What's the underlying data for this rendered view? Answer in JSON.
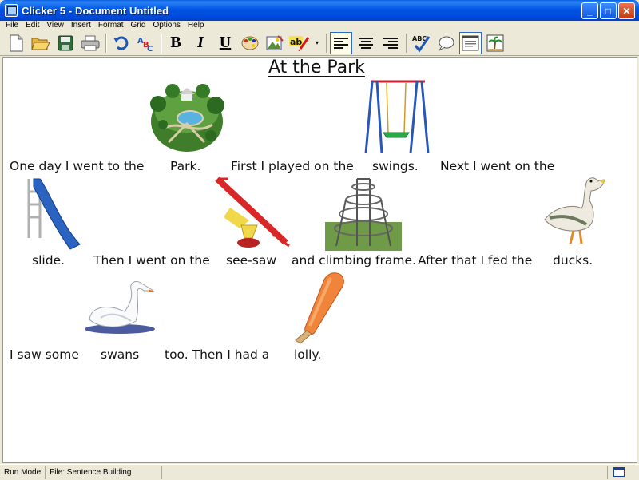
{
  "window": {
    "title": "Clicker 5 - Document Untitled",
    "controls": {
      "minimize": "_",
      "maximize": "□",
      "close": "✕"
    }
  },
  "menu": [
    "File",
    "Edit",
    "View",
    "Insert",
    "Format",
    "Grid",
    "Options",
    "Help"
  ],
  "toolbar": {
    "bold": "B",
    "italic": "I",
    "underline": "U",
    "abc_label": "ABC",
    "spell_label": "ab",
    "spell_sub": "c",
    "dropdown": "▾"
  },
  "document": {
    "title": "At the Park",
    "lines": [
      {
        "segments": [
          "One day I went to the",
          "Park.",
          "First I played on the",
          "swings.",
          "Next I went on the"
        ]
      },
      {
        "segments": [
          "slide.",
          "Then I went on the",
          "see-saw",
          "and climbing frame.",
          "After that I fed the",
          "ducks."
        ]
      },
      {
        "segments": [
          "I saw some",
          "swans",
          "too. Then I had a",
          "lolly."
        ]
      }
    ],
    "pictures": [
      "park-picture",
      "swing-picture",
      "slide-picture",
      "see-saw-picture",
      "climbing-frame-picture",
      "duck-picture",
      "swan-picture",
      "lolly-picture"
    ]
  },
  "status": {
    "mode": "Run Mode",
    "file": "File: Sentence Building"
  },
  "colors": {
    "titlebar": "#0055e5",
    "chrome": "#ece9d8",
    "document_bg": "#ffffff"
  }
}
